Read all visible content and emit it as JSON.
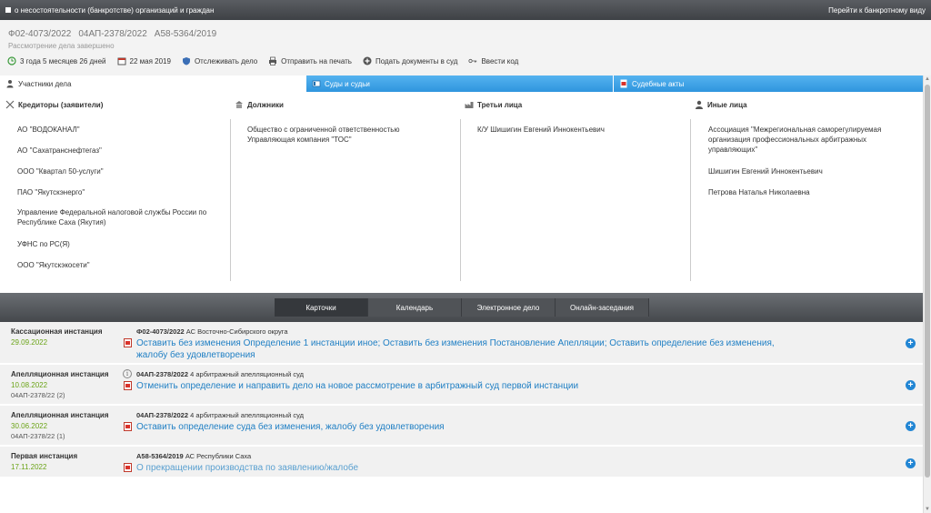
{
  "topbar": {
    "title": "о несостоятельности (банкротстве) организаций и граждан",
    "link": "Перейти к банкротному виду"
  },
  "case": {
    "numbers": [
      "Ф02-4073/2022",
      "04АП-2378/2022",
      "А58-5364/2019"
    ],
    "status": "Рассмотрение дела завершено"
  },
  "toolbar": {
    "duration": "3 года 5 месяцев 26 дней",
    "date": "22 мая 2019",
    "track": "Отслеживать дело",
    "print": "Отправить на печать",
    "submit": "Подать документы в суд",
    "code": "Ввести код"
  },
  "tabs": {
    "participants": "Участники дела",
    "courts": "Суды и судьи",
    "acts": "Судебные акты"
  },
  "participants": {
    "creditors": {
      "title": "Кредиторы (заявители)",
      "items": [
        "АО \"ВОДОКАНАЛ\"",
        "АО \"Сахатранснефтегаз\"",
        "ООО \"Квартал 50-услуги\"",
        "ПАО \"Якутскэнерго\"",
        "Управление Федеральной налоговой службы России по Республике Саха (Якутия)",
        "УФНС по РС(Я)",
        "ООО \"Якутскэкосети\""
      ]
    },
    "debtors": {
      "title": "Должники",
      "items": [
        "Общество с ограниченной ответственностью Управляющая компания \"ТОС\""
      ]
    },
    "third": {
      "title": "Третьи лица",
      "items": [
        "К/У Шишигин Евгений Иннокентьевич"
      ]
    },
    "others": {
      "title": "Иные лица",
      "items": [
        "Ассоциация \"Межрегиональная саморегулируемая организация профессиональных арбитражных управляющих\"",
        "Шишигин Евгений Иннокентьевич",
        "Петрова Наталья Николаевна"
      ]
    }
  },
  "view_buttons": [
    "Карточки",
    "Календарь",
    "Электронное дело",
    "Онлайн-заседания"
  ],
  "instances": [
    {
      "type": "Кассационная инстанция",
      "date": "29.09.2022",
      "sub": [],
      "case": "Ф02-4073/2022",
      "court": "АС Восточно-Сибирского округа",
      "text_line1": "Оставить без изменения Определение 1 инстанции иное; Оставить без изменения Постановление Апелляции; Оставить определение без изменения,",
      "text_line2": "жалобу без удовлетворения"
    },
    {
      "type": "Апелляционная инстанция",
      "date": "10.08.2022",
      "sub": [
        "04АП-2378/22 (2)"
      ],
      "case": "04АП-2378/2022",
      "court": "4 арбитражный апелляционный суд",
      "text_line1": "Отменить определение и направить дело на новое рассмотрение в арбитражный суд первой инстанции",
      "text_line2": ""
    },
    {
      "type": "Апелляционная инстанция",
      "date": "30.06.2022",
      "sub": [
        "04АП-2378/22 (1)"
      ],
      "case": "04АП-2378/2022",
      "court": "4 арбитражный апелляционный суд",
      "text_line1": "Оставить определение суда без изменения, жалобу без удовлетворения",
      "text_line2": ""
    },
    {
      "type": "Первая инстанция",
      "date": "17.11.2022",
      "sub": [],
      "case": "А58-5364/2019",
      "court": "АС Республики Саха",
      "text_line1": "О прекращении производства по заявлению/жалобе",
      "text_line2": ""
    }
  ],
  "icons": {
    "plus": "+",
    "info": "i"
  }
}
